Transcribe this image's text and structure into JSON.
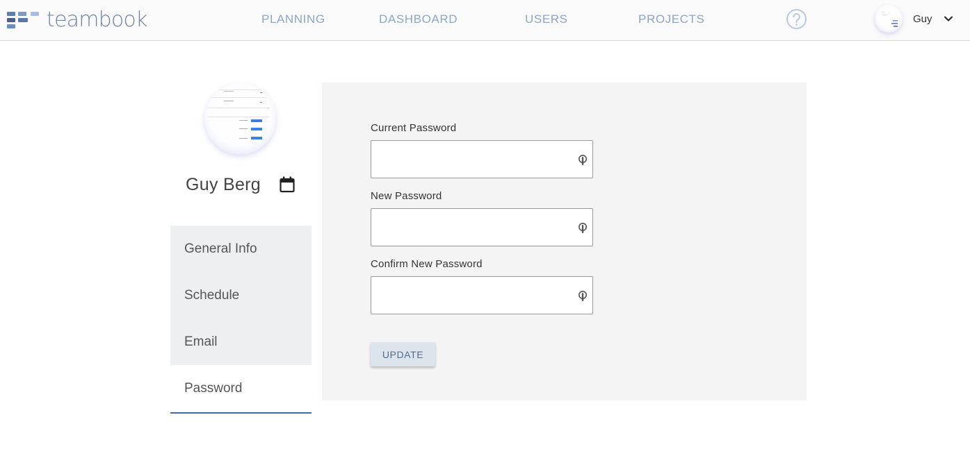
{
  "app": {
    "name": "teambook"
  },
  "nav": [
    {
      "label": "PLANNING"
    },
    {
      "label": "DASHBOARD"
    },
    {
      "label": "USERS"
    },
    {
      "label": "PROJECTS"
    }
  ],
  "header": {
    "user_name": "Guy",
    "help_icon": "help-circle-icon",
    "menu_icon": "chevron-down-icon"
  },
  "profile": {
    "name": "Guy Berg",
    "calendar_icon": "calendar-icon"
  },
  "sidebar": {
    "items": [
      {
        "label": "General Info",
        "active": false
      },
      {
        "label": "Schedule",
        "active": false
      },
      {
        "label": "Email",
        "active": false
      },
      {
        "label": "Password",
        "active": true
      }
    ]
  },
  "form": {
    "current_password": {
      "label": "Current Password",
      "value": ""
    },
    "new_password": {
      "label": "New Password",
      "value": ""
    },
    "confirm_password": {
      "label": "Confirm New Password",
      "value": ""
    },
    "update_label": "UPDATE",
    "field_icon": "key-icon"
  },
  "colors": {
    "nav_text": "#8aa6c8",
    "logo_text": "#6f86a4",
    "active_underline": "#3f6b9e",
    "sidebar_bg": "#eeeff1",
    "panel_bg": "#f4f4f4",
    "button_bg": "#dde4ec",
    "button_text": "#4d6c91"
  }
}
